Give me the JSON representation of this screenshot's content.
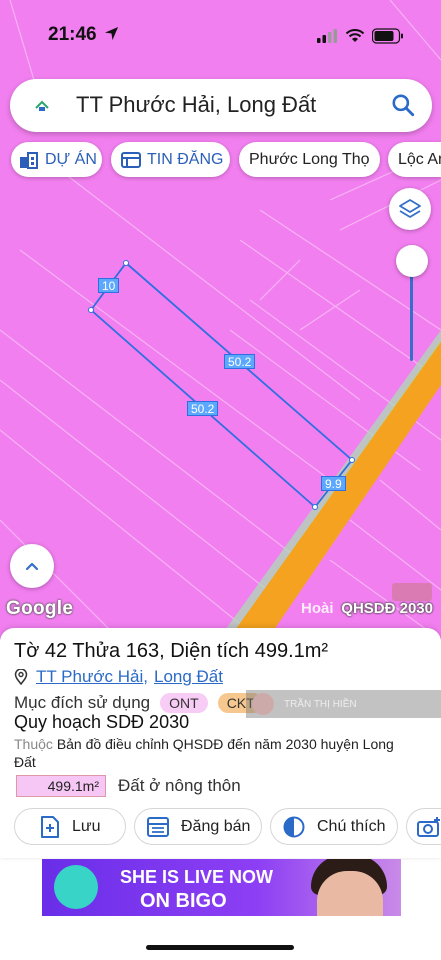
{
  "status_bar": {
    "time": "21:46"
  },
  "search": {
    "query": "TT Phước Hải, Long Đất"
  },
  "chips": [
    {
      "label": "DỰ ÁN",
      "icon": "building-icon"
    },
    {
      "label": "TIN ĐĂNG",
      "icon": "listing-icon"
    },
    {
      "label": "Phước Long Thọ"
    },
    {
      "label": "Lộc An"
    }
  ],
  "map": {
    "edge_labels": [
      "10",
      "50.2",
      "50.2",
      "9.9"
    ],
    "brand": "Google",
    "partial_label": "Hoài",
    "layer_label": "QHSDĐ 2030",
    "colors": {
      "land": "#f27ff0",
      "road": "#f4a21f",
      "parcel_outline": "#2f6fe0"
    }
  },
  "parcel": {
    "title": "Tờ 42 Thửa 163, Diện tích 499.1m²",
    "commune": "TT Phước Hải",
    "district": "Long Đất",
    "purpose_label": "Mục đích sử dụng",
    "tags": [
      "ONT",
      "CKT"
    ],
    "overlay_user": "TRẦN THỊ HIỀN",
    "plan_title": "Quy hoạch SDĐ 2030",
    "source_prefix": "Thuộc",
    "source_text": "Bản đồ điều chỉnh QHSDĐ đến năm 2030 huyện Long Đất",
    "area_value": "499.1m²",
    "area_label": "Đất ở nông thôn"
  },
  "actions": [
    {
      "label": "Lưu",
      "icon": "save-add-icon"
    },
    {
      "label": "Đăng bán",
      "icon": "sell-post-icon"
    },
    {
      "label": "Chú thích",
      "icon": "legend-icon"
    },
    {
      "label": "",
      "icon": "camera-add-icon"
    }
  ],
  "ad": {
    "line1": "SHE IS LIVE NOW",
    "line2": "ON BIGO"
  }
}
